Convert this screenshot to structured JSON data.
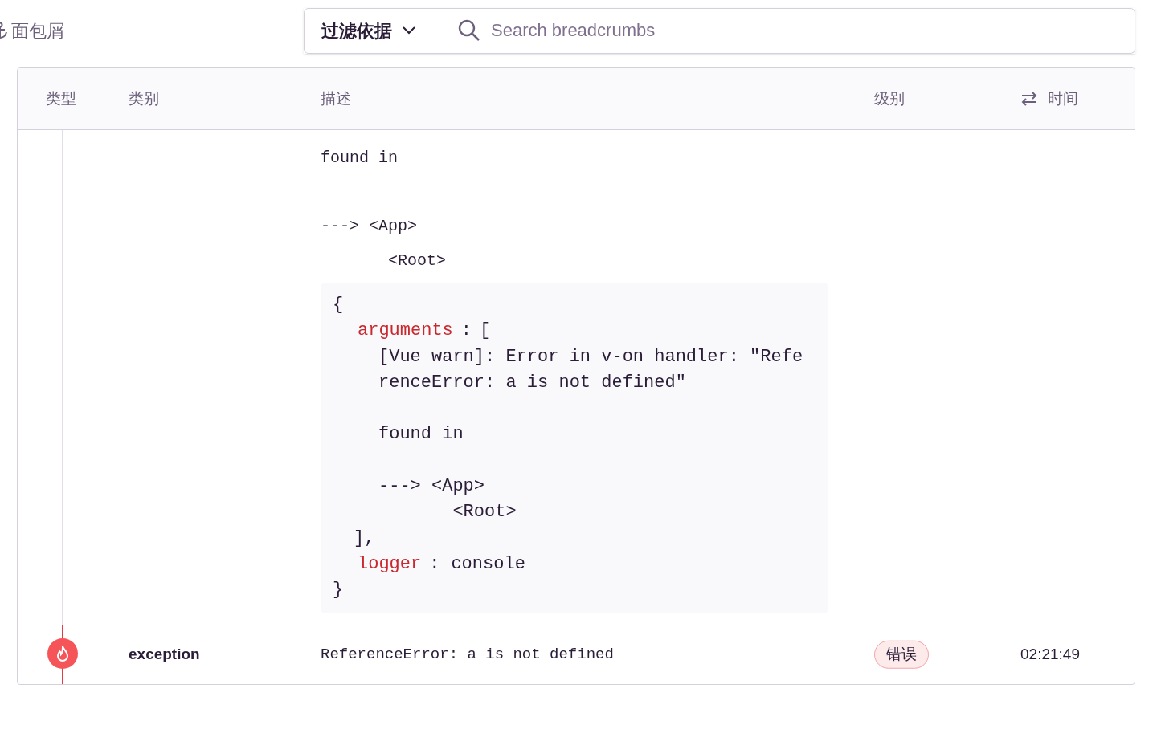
{
  "title": "面包屑",
  "filter": {
    "label": "过滤依据"
  },
  "search": {
    "placeholder": "Search breadcrumbs"
  },
  "columns": [
    {
      "label": "类型",
      "kind": "plain"
    },
    {
      "label": "类别",
      "kind": "plain"
    },
    {
      "label": "描述",
      "kind": "plain"
    },
    {
      "label": "级别",
      "kind": "plain"
    },
    {
      "label": "时间",
      "kind": "sortable"
    }
  ],
  "expanded": {
    "message": "found in\n\n---> <App>\n       <Root>",
    "data": {
      "open": "{",
      "close": "}",
      "entries": [
        {
          "key": "arguments",
          "separator": ":",
          "kind": "list",
          "open": "[",
          "items": [
            "[Vue warn]: Error in v-on handler: \"ReferenceError: a is not defined\"\n\nfound in\n\n---> <App>\n       <Root>"
          ],
          "close": "],"
        },
        {
          "key": "logger",
          "separator": ":",
          "kind": "value",
          "value": "console"
        }
      ]
    }
  },
  "rows": [
    {
      "kind": "error",
      "category": "exception",
      "message": "ReferenceError: a is not defined",
      "level": "错误",
      "time": "02:21:49"
    }
  ]
}
